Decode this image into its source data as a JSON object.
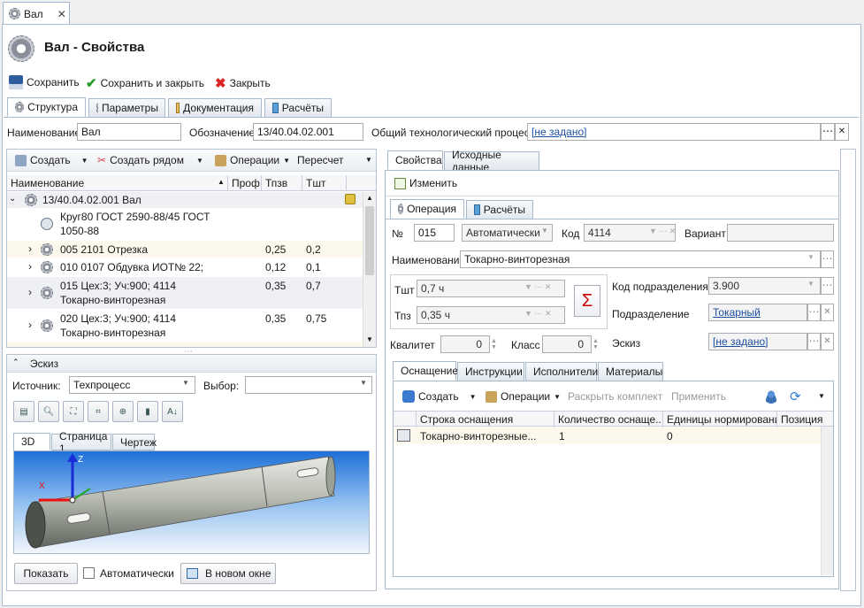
{
  "window_tab": {
    "title": "Вал",
    "close": "✕"
  },
  "header": {
    "title": "Вал - Свойства"
  },
  "toolbar": {
    "save": "Сохранить",
    "save_close": "Сохранить и закрыть",
    "close": "Закрыть"
  },
  "main_tabs": [
    "Структура",
    "Параметры",
    "Документация",
    "Расчёты"
  ],
  "form": {
    "name_label": "Наименование",
    "name_value": "Вал",
    "designation_label": "Обозначение",
    "designation_value": "13/40.04.02.001",
    "process_label": "Общий технологический процесс",
    "process_value": "[не задано]"
  },
  "tree_toolbar": {
    "create": "Создать",
    "create_near": "Создать рядом",
    "operations": "Операции",
    "recalc": "Пересчет"
  },
  "tree_columns": [
    "Наименование",
    "Проф",
    "Тпзв",
    "Тшт"
  ],
  "tree_rows": [
    {
      "name": "13/40.04.02.001  Вал",
      "tpz": "",
      "tsh": ""
    },
    {
      "name": "Круг80 ГОСТ 2590-88/45 ГОСТ",
      "name2": "1050-88",
      "tpz": "",
      "tsh": ""
    },
    {
      "name": "005  2101  Отрезка",
      "tpz": "0,25",
      "tsh": "0,2"
    },
    {
      "name": "010  0107  Обдувка  ИОТ№ 22;",
      "tpz": "0,12",
      "tsh": "0,1"
    },
    {
      "name": "015  Цех:3; Уч:900;  4114",
      "name2": "Токарно-винторезная",
      "tpz": "0,35",
      "tsh": "0,7"
    },
    {
      "name": "020  Цех:3; Уч:900;  4114",
      "name2": "Токарно-винторезная",
      "tpz": "0,35",
      "tsh": "0,75"
    }
  ],
  "sketch": {
    "title": "Эскиз",
    "source_label": "Источник:",
    "source_value": "Техпроцесс",
    "select_label": "Выбор:",
    "tabs": [
      "3D",
      "Страница 1",
      "Чертеж"
    ],
    "show": "Показать",
    "auto": "Автоматически",
    "new_window": "В новом окне",
    "axes": {
      "x": "X",
      "z": "Z"
    }
  },
  "right_tabs": [
    "Свойства",
    "Исходные данные"
  ],
  "edit": "Изменить",
  "op_tabs": [
    "Операция",
    "Расчёты"
  ],
  "operation": {
    "num_label": "№",
    "num_value": "015",
    "mode_value": "Автоматически",
    "code_label": "Код",
    "code_value": "4114",
    "variant_label": "Вариант",
    "name_label": "Наименование",
    "name_value": "Токарно-винторезная",
    "tsh_label": "Тшт",
    "tsh_value": "0,7 ч",
    "tpz_label": "Тпз",
    "tpz_value": "0,35 ч",
    "sigma": "Σ",
    "dept_code_label": "Код подразделения",
    "dept_code_value": "3.900",
    "dept_label": "Подразделение",
    "dept_value": "Токарный",
    "sketch_label": "Эскиз",
    "sketch_value": "[не задано]",
    "qual_label": "Квалитет",
    "qual_value": "0",
    "class_label": "Класс",
    "class_value": "0"
  },
  "equip_tabs": [
    "Оснащение",
    "Инструкции",
    "Исполнители",
    "Материалы"
  ],
  "equip_toolbar": {
    "create": "Создать",
    "operations": "Операции",
    "expand": "Раскрыть комплект",
    "apply": "Применить"
  },
  "equip_columns": [
    "Строка оснащения",
    "Количество оснаще...",
    "Единицы нормирования",
    "Позиция"
  ],
  "equip_rows": [
    {
      "name": "Токарно-винторезные...",
      "qty": "1",
      "units": "0",
      "pos": ""
    }
  ]
}
